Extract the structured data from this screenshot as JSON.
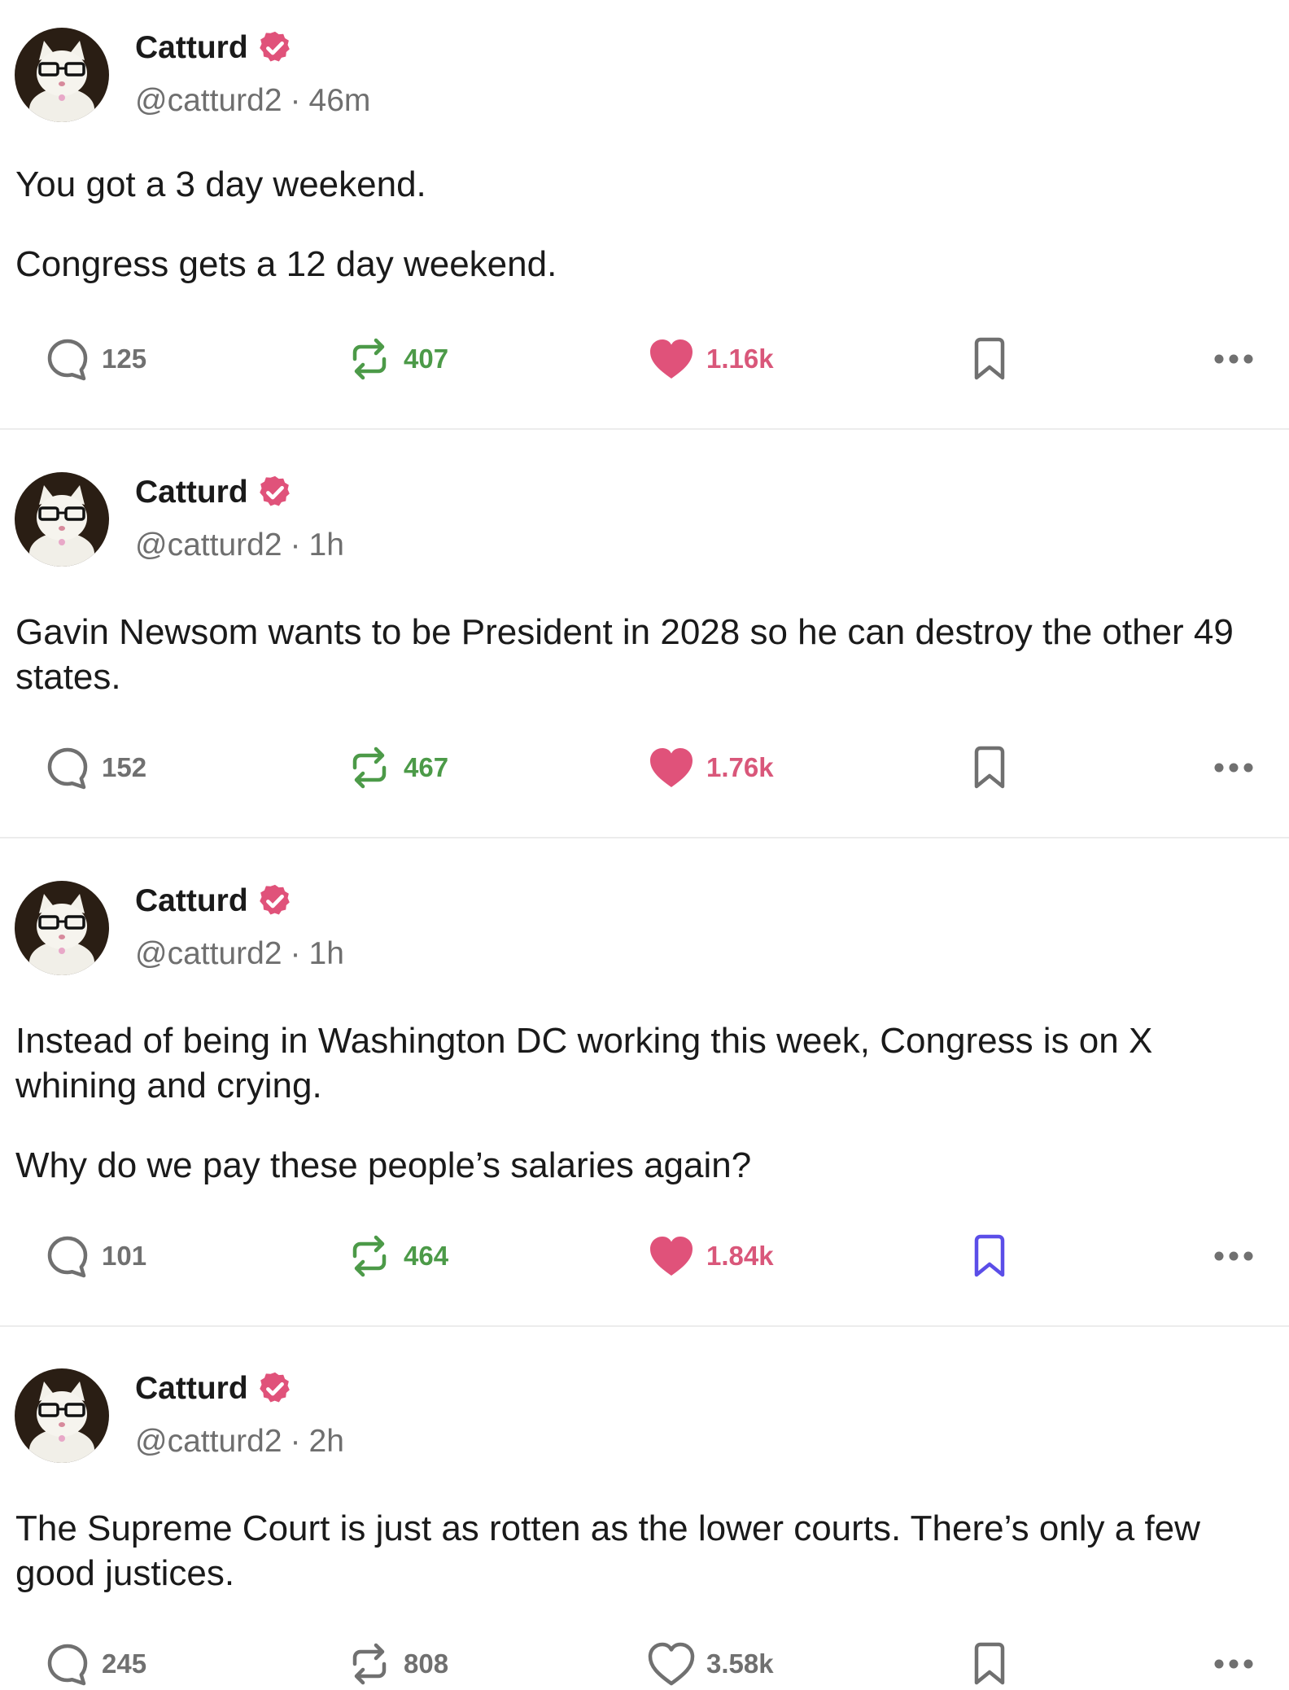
{
  "posts": [
    {
      "author": "Catturd",
      "handle": "@catturd2",
      "separator": "·",
      "time": "46m",
      "paragraphs": [
        "You got a 3 day weekend.",
        "Congress gets a 12 day weekend."
      ],
      "replies": "125",
      "reposts": "407",
      "likes": "1.16k",
      "bookmarked": false
    },
    {
      "author": "Catturd",
      "handle": "@catturd2",
      "separator": "·",
      "time": "1h",
      "paragraphs": [
        "Gavin Newsom wants to be President in 2028 so he can destroy the other 49 states."
      ],
      "replies": "152",
      "reposts": "467",
      "likes": "1.76k",
      "bookmarked": false
    },
    {
      "author": "Catturd",
      "handle": "@catturd2",
      "separator": "·",
      "time": "1h",
      "paragraphs": [
        "Instead of being in Washington DC working this week, Congress is on X whining and crying.",
        "Why do we pay these people’s salaries again?"
      ],
      "replies": "101",
      "reposts": "464",
      "likes": "1.84k",
      "bookmarked": true
    },
    {
      "author": "Catturd",
      "handle": "@catturd2",
      "separator": "·",
      "time": "2h",
      "paragraphs": [
        "The Supreme Court is just as rotten as the lower courts. There’s only a few good justices."
      ],
      "replies": "245",
      "reposts": "808",
      "likes": "3.58k",
      "bookmarked": false
    }
  ],
  "icons": {
    "avatar": "cat-with-glasses-avatar",
    "verified": "verified-badge-icon",
    "reply": "reply-bubble-icon",
    "repost": "repost-icon",
    "like": "heart-icon",
    "bookmark": "bookmark-icon",
    "more": "more-dots-icon"
  },
  "colors": {
    "verified": "#e0527a",
    "like": "#d9577a",
    "repost": "#4c9a48",
    "bookmark_active": "#5b4ee8",
    "muted": "#6f6f6f"
  }
}
